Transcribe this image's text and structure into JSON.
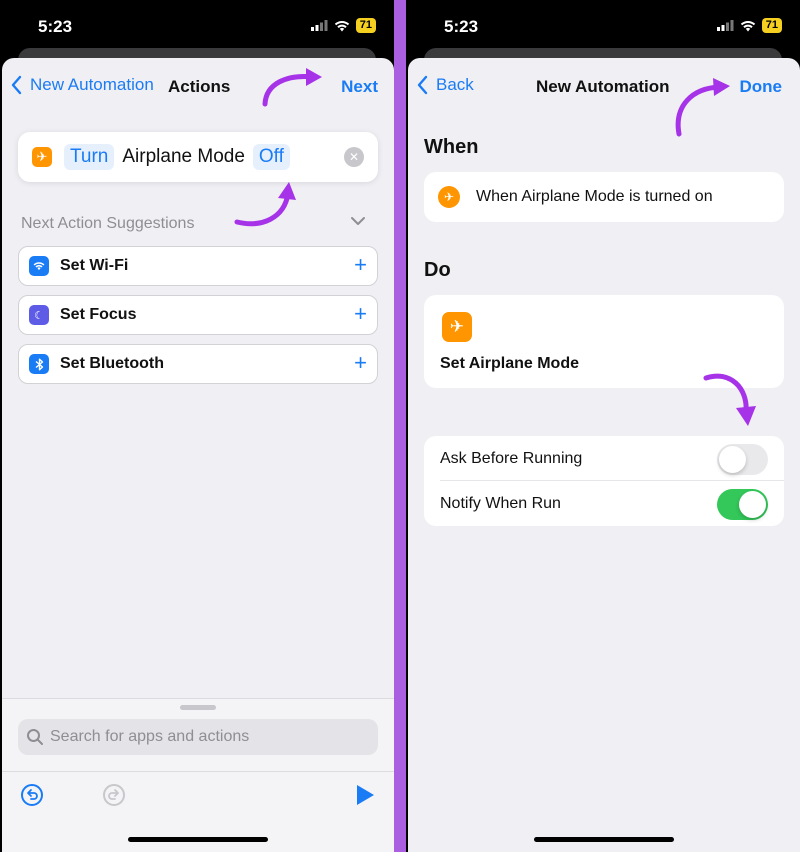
{
  "colors": {
    "accent": "#1a7cf5",
    "annotation_arrow": "#a633e8",
    "airplane_icon": "#ff9500",
    "wifi_icon": "#1a7cf5",
    "focus_icon": "#5e5ce6",
    "bluetooth_icon": "#1a7cf5",
    "toggle_on": "#34c759"
  },
  "left_screen": {
    "status_bar": {
      "time": "5:23",
      "battery": "71"
    },
    "nav": {
      "back_label": "New Automation",
      "title": "Actions",
      "next_label": "Next"
    },
    "action": {
      "icon": "airplane-icon",
      "verb": "Turn",
      "subject": "Airplane Mode",
      "state": "Off"
    },
    "suggestions": {
      "header": "Next Action Suggestions",
      "items": [
        {
          "label": "Set Wi-Fi",
          "icon": "wifi-icon"
        },
        {
          "label": "Set Focus",
          "icon": "moon-icon"
        },
        {
          "label": "Set Bluetooth",
          "icon": "bluetooth-icon"
        }
      ]
    },
    "search": {
      "placeholder": "Search for apps and actions"
    }
  },
  "right_screen": {
    "status_bar": {
      "time": "5:23",
      "battery": "71"
    },
    "nav": {
      "back_label": "Back",
      "title": "New Automation",
      "done_label": "Done"
    },
    "when": {
      "title": "When",
      "trigger": "When Airplane Mode is turned on"
    },
    "do": {
      "title": "Do",
      "action_label": "Set Airplane Mode"
    },
    "settings": [
      {
        "label": "Ask Before Running",
        "on": false
      },
      {
        "label": "Notify When Run",
        "on": true
      }
    ]
  }
}
